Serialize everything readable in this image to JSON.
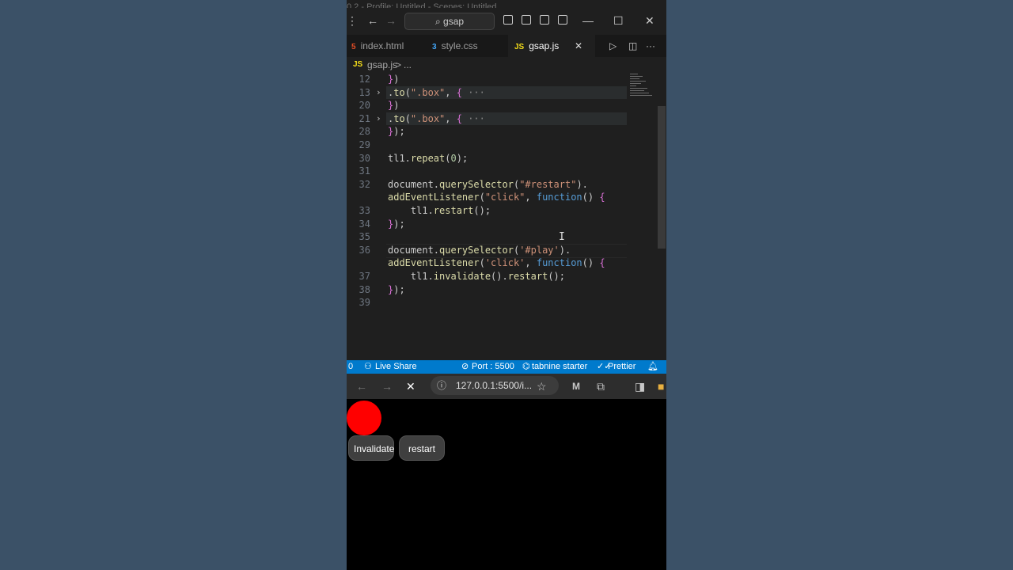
{
  "window": {
    "faint_title": "0.2 - Profile: Untitled - Scenes: Untitled",
    "search_label": "gsap",
    "controls": [
      "minimize",
      "maximize",
      "close"
    ]
  },
  "tabs": [
    {
      "icon_text": "5",
      "label": "index.html",
      "icon_color": "#e44d26"
    },
    {
      "icon_text": "3",
      "label": "style.css",
      "icon_color": "#42a5f5"
    },
    {
      "icon_text": "JS",
      "label": "gsap.js",
      "icon_color": "#f5de19",
      "close": "✕"
    }
  ],
  "breadcrumb": {
    "icon": "JS",
    "file": "gsap.js",
    "sep": ">",
    "rest": "..."
  },
  "editor": {
    "lines": [
      {
        "n": "12",
        "text": "})"
      },
      {
        "n": "13",
        "text": ".to(\".box\", {",
        "fold": "›",
        "collapsed": "···"
      },
      {
        "n": "20",
        "text": "})"
      },
      {
        "n": "21",
        "text": ".to(\".box\", {",
        "fold": "›",
        "collapsed": "···"
      },
      {
        "n": "28",
        "text": "});"
      },
      {
        "n": "29",
        "text": ""
      },
      {
        "n": "30",
        "text": "tl1.repeat(0);"
      },
      {
        "n": "31",
        "text": ""
      },
      {
        "n": "32",
        "text": "document.querySelector(\"#restart\")."
      },
      {
        "n": "",
        "text": "addEventListener(\"click\", function() {"
      },
      {
        "n": "33",
        "text": "    tl1.restart();"
      },
      {
        "n": "34",
        "text": "});"
      },
      {
        "n": "35",
        "text": ""
      },
      {
        "n": "36",
        "text": "document.querySelector('#play')."
      },
      {
        "n": "",
        "text": "addEventListener('click', function() {"
      },
      {
        "n": "37",
        "text": "    tl1.invalidate().restart();"
      },
      {
        "n": "38",
        "text": "});"
      },
      {
        "n": "39",
        "text": ""
      }
    ]
  },
  "statusbar": {
    "left": "0",
    "live_share": "Live Share",
    "port": "Port : 5500",
    "tabnine": "tabnine starter",
    "prettier": "Prettier"
  },
  "browser": {
    "url": "127.0.0.1:5500/i..."
  },
  "page": {
    "invalidate_label": "Invalidate",
    "restart_label": "restart",
    "ball_color": "#ff0000"
  }
}
